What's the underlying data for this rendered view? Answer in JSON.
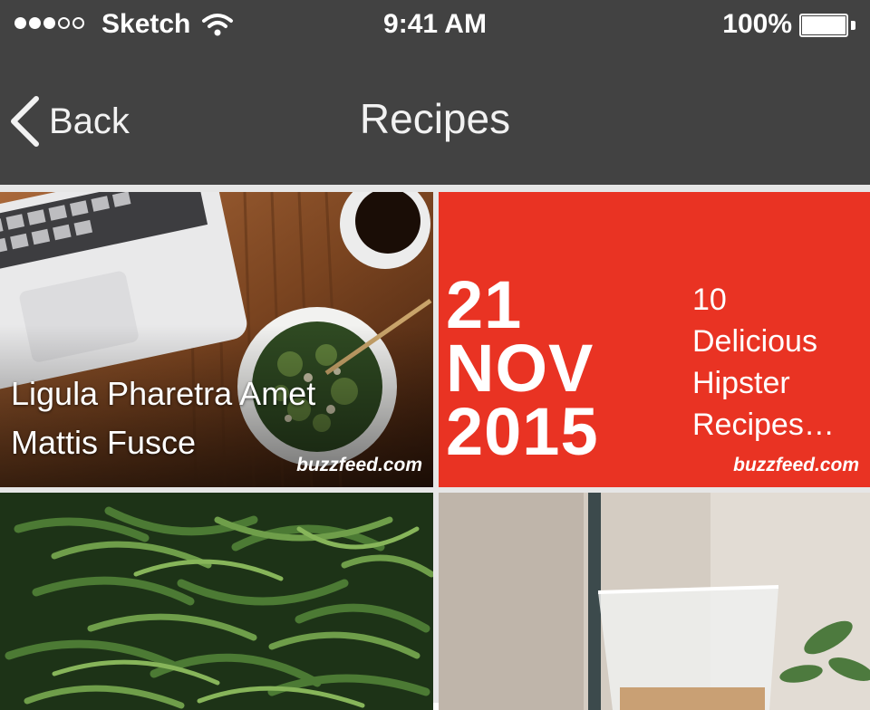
{
  "status_bar": {
    "carrier": "Sketch",
    "time": "9:41 AM",
    "battery": "100%"
  },
  "nav": {
    "back_label": "Back",
    "title": "Recipes"
  },
  "tiles": [
    {
      "title_lines": [
        "Ligula Pharetra Amet",
        "Mattis Fusce"
      ],
      "source": "buzzfeed.com"
    },
    {
      "date_lines": [
        "21",
        "NOV",
        "2015"
      ],
      "headline_lines": [
        "10",
        "Delicious",
        "Hipster",
        "Recipes…"
      ],
      "source": "buzzfeed.com",
      "color": "#e93323"
    },
    {},
    {}
  ],
  "colors": {
    "bar": "#424242",
    "accent_red": "#e93323"
  }
}
